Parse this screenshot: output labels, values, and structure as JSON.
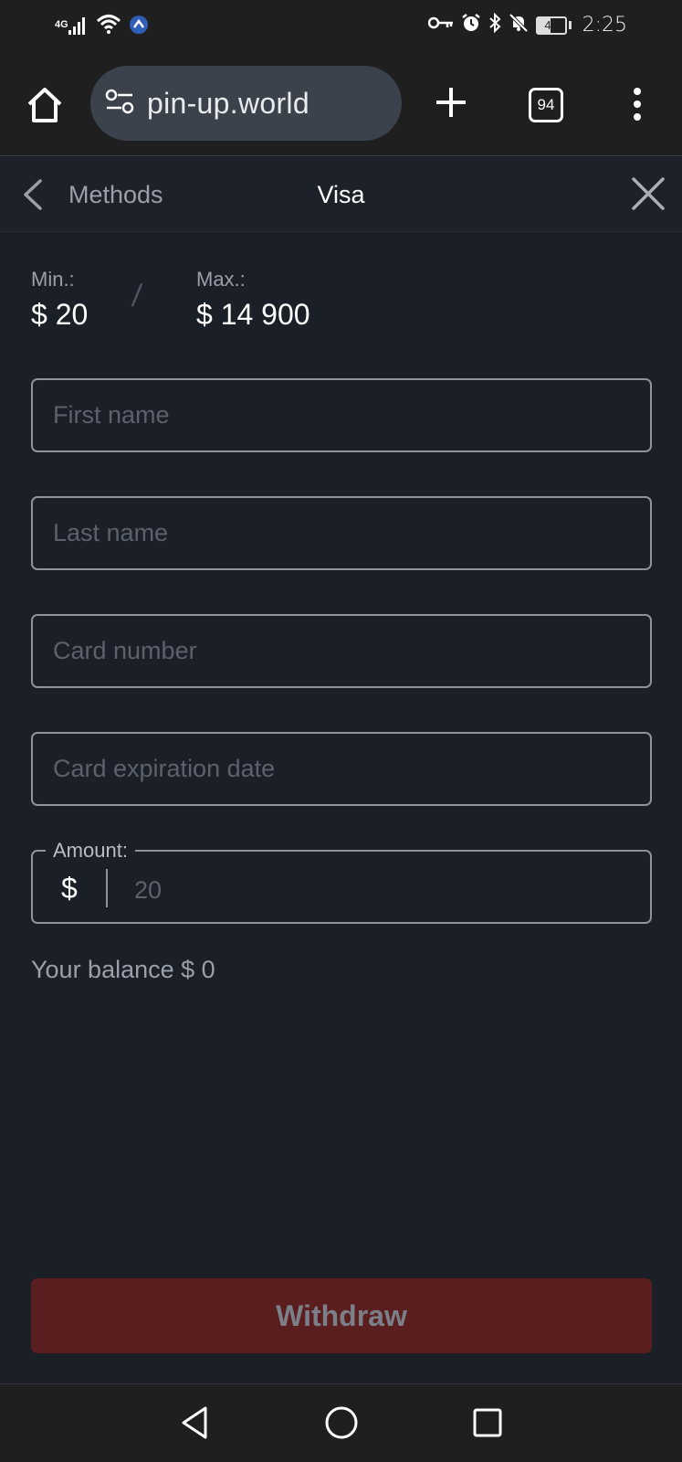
{
  "status_bar": {
    "network_type": "4G",
    "battery": "47",
    "time": "2:25",
    "icons": [
      "signal-icon",
      "wifi-icon",
      "vpn-icon",
      "key-icon",
      "alarm-icon",
      "bluetooth-icon",
      "mute-icon",
      "battery-icon"
    ]
  },
  "browser": {
    "url": "pin-up.world",
    "tab_count": "94",
    "icons": [
      "home-icon",
      "site-settings-icon",
      "new-tab-icon",
      "tabs-icon",
      "more-icon"
    ]
  },
  "header": {
    "back_label": "Methods",
    "title": "Visa"
  },
  "limits": {
    "min_label": "Min.:",
    "min_value": "$ 20",
    "separator": "/",
    "max_label": "Max.:",
    "max_value": "$ 14 900"
  },
  "form": {
    "first_name_placeholder": "First name",
    "last_name_placeholder": "Last name",
    "card_number_placeholder": "Card number",
    "card_expiration_placeholder": "Card expiration date",
    "amount_label": "Amount:",
    "amount_currency": "$",
    "amount_placeholder": "20"
  },
  "balance": "Your balance $ 0",
  "withdraw_label": "Withdraw",
  "colors": {
    "background": "#1b1f27",
    "withdraw_button": "#5a1e1e",
    "field_border": "#8f949c"
  }
}
